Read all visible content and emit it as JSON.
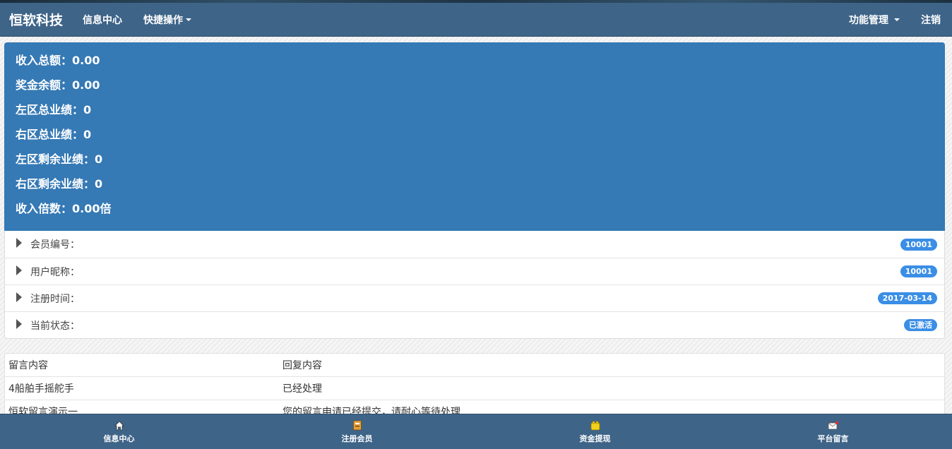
{
  "navbar": {
    "brand": "恒软科技",
    "links": [
      {
        "label": "信息中心"
      },
      {
        "label": "快捷操作"
      }
    ],
    "right_links": [
      {
        "label": "功能管理"
      },
      {
        "label": "注销"
      }
    ]
  },
  "stats": [
    "收入总额：0.00",
    "奖金余额：0.00",
    "左区总业绩：0",
    "右区总业绩：0",
    "左区剩余业绩：0",
    "右区剩余业绩：0",
    "收入倍数：0.00倍"
  ],
  "info": [
    {
      "label": "会员编号：",
      "badge": "10001"
    },
    {
      "label": "用户昵称：",
      "badge": "10001"
    },
    {
      "label": "注册时间：",
      "badge": "2017-03-14"
    },
    {
      "label": "当前状态：",
      "badge": "已激活"
    }
  ],
  "messages": {
    "headers": [
      "留言内容",
      "回复内容"
    ],
    "rows": [
      [
        "4船舶手摇舵手",
        "已经处理"
      ],
      [
        "恒软留言演示一",
        "您的留言申请已经提交，请耐心等待处理"
      ]
    ]
  },
  "bottom_tabs": [
    {
      "label": "信息中心",
      "icon": "home-icon"
    },
    {
      "label": "注册会员",
      "icon": "register-book-icon"
    },
    {
      "label": "资金提现",
      "icon": "wallet-icon"
    },
    {
      "label": "平台留言",
      "icon": "mail-icon"
    }
  ],
  "colors": {
    "navbar": "#3e6488",
    "stats_panel": "#3579b5",
    "badge": "#3a8ee6"
  }
}
